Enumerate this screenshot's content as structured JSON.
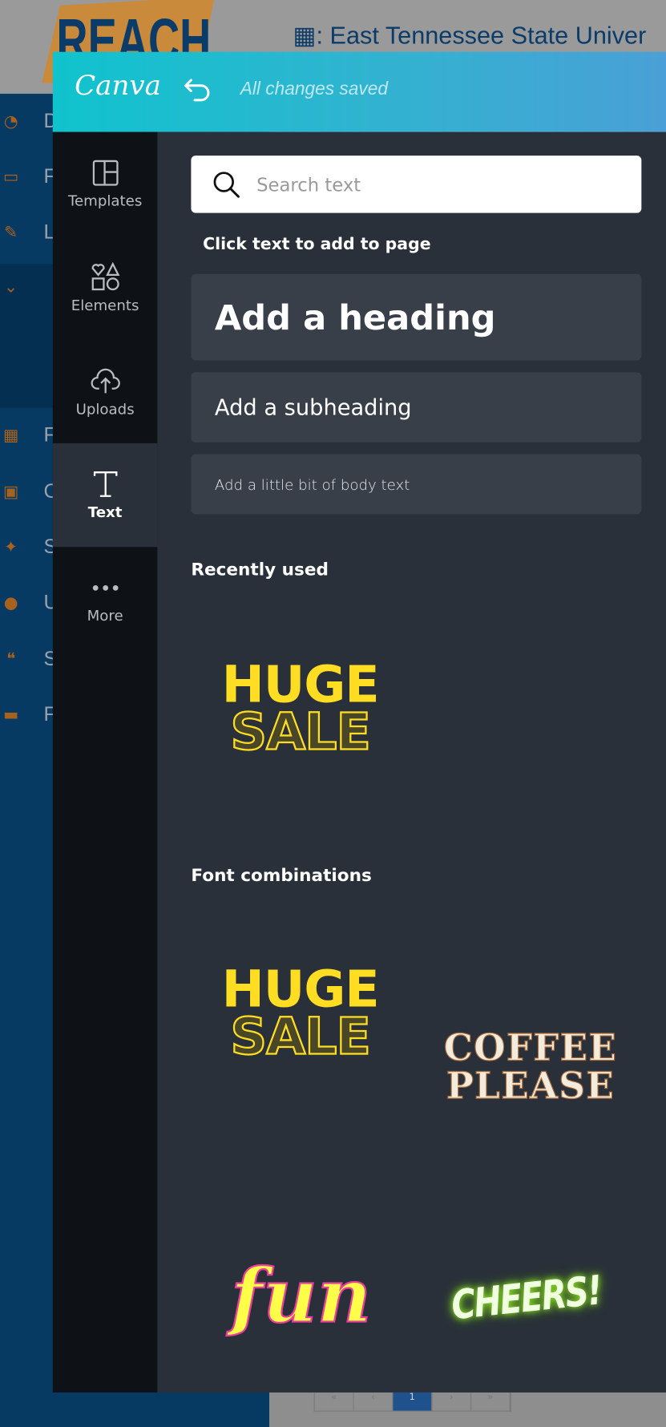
{
  "background_page": {
    "logo_text": "REACH",
    "org_icon": "building-icon",
    "org_title": ": East Tennessee State Univer",
    "nav_items": [
      {
        "icon": "dashboard-icon",
        "letter": "D"
      },
      {
        "icon": "drive-icon",
        "letter": "F"
      },
      {
        "icon": "edit-icon",
        "letter": "L"
      },
      {
        "icon": "chevron-down-icon",
        "letter": ""
      },
      {
        "icon": "film-icon",
        "letter": "F"
      },
      {
        "icon": "calendar-icon",
        "letter": "C"
      },
      {
        "icon": "twitter-icon",
        "letter": "S"
      },
      {
        "icon": "users-icon",
        "letter": "U"
      },
      {
        "icon": "comments-icon",
        "letter": "S"
      },
      {
        "icon": "monitor-icon",
        "letter": "F"
      }
    ],
    "pagination": [
      "«",
      "‹",
      "1",
      "›",
      "»"
    ],
    "pagination_active": "1",
    "colors": {
      "sidebar": "#063a62",
      "icon": "#a8621f",
      "active_page": "#1f528c"
    }
  },
  "canva": {
    "brand": "Canva",
    "undo_icon": "undo-icon",
    "save_status": "All changes saved",
    "rail": [
      {
        "label": "Templates",
        "icon": "templates-icon"
      },
      {
        "label": "Elements",
        "icon": "elements-icon"
      },
      {
        "label": "Uploads",
        "icon": "upload-cloud-icon"
      },
      {
        "label": "Text",
        "icon": "text-icon",
        "active": true
      },
      {
        "label": "More",
        "icon": "more-dots-icon"
      }
    ],
    "search": {
      "placeholder": "Search text",
      "value": ""
    },
    "click_hint": "Click text to add to page",
    "add_heading": "Add a heading",
    "add_subheading": "Add a subheading",
    "add_body": "Add a little bit of body text",
    "recently_used_title": "Recently used",
    "recently_used": [
      {
        "line1": "HUGE",
        "line2": "SALE"
      }
    ],
    "font_combinations_title": "Font combinations",
    "font_combinations": [
      {
        "line1": "HUGE",
        "line2": "SALE"
      },
      {
        "line1": "COFFEE",
        "line2": "PLEASE"
      },
      {
        "line1": "fun"
      },
      {
        "line1": "CHEERS!"
      }
    ],
    "colors": {
      "header_start": "#10c3cd",
      "header_end": "#4aa0d6",
      "rail": "#0e1115",
      "panel": "#293039",
      "button": "#383f48"
    }
  }
}
